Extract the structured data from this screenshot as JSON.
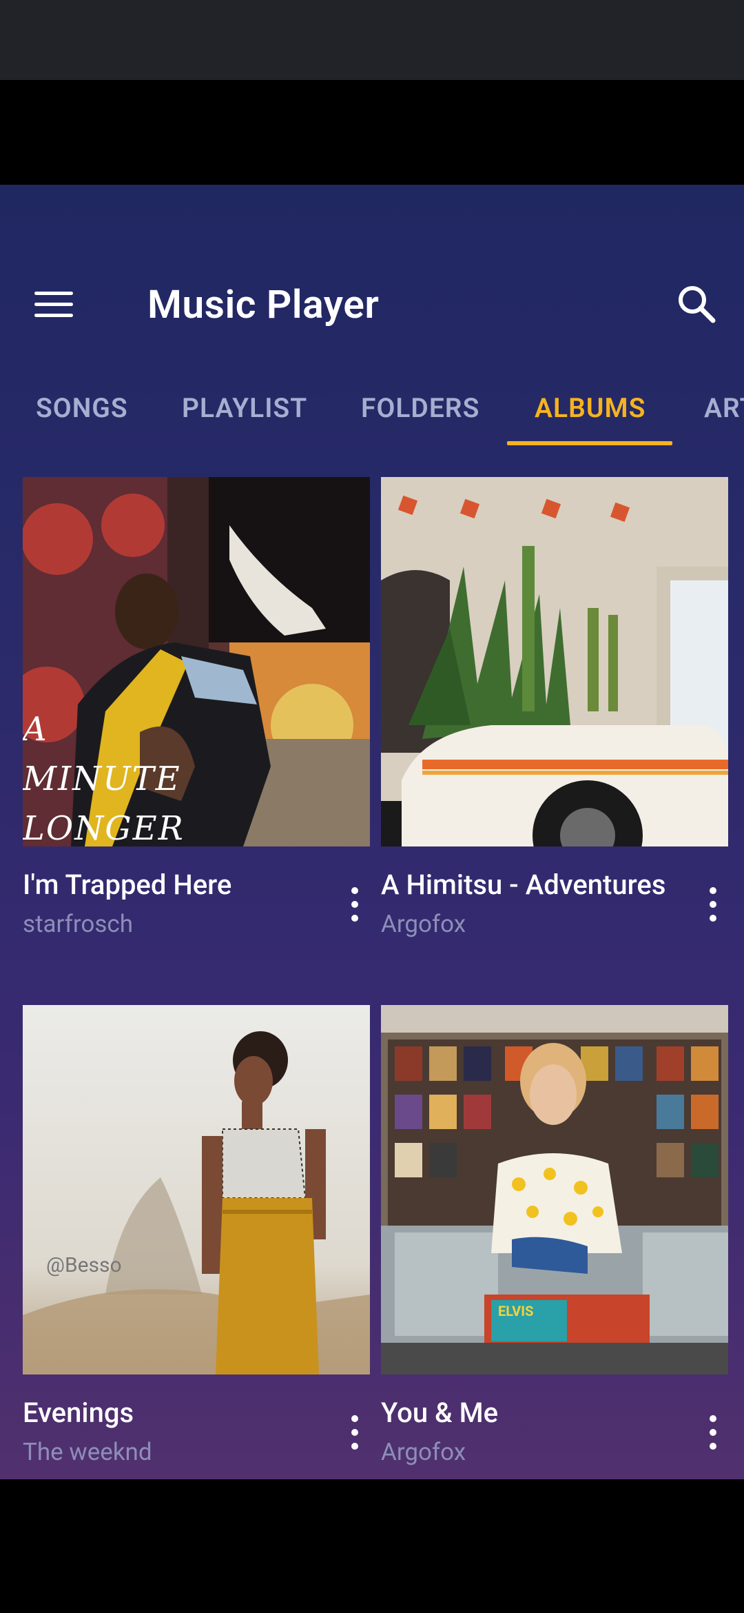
{
  "app": {
    "title": "Music Player"
  },
  "tabs": [
    {
      "label": "SONGS",
      "active": false
    },
    {
      "label": "PLAYLIST",
      "active": false
    },
    {
      "label": "FOLDERS",
      "active": false
    },
    {
      "label": "ALBUMS",
      "active": true
    },
    {
      "label": "ARTISTS",
      "active": false
    }
  ],
  "albums": [
    {
      "title": "I'm Trapped Here",
      "artist": "starfrosch",
      "cover_text": "A MINUTE LONGER"
    },
    {
      "title": "A Himitsu - Adventures",
      "artist": "Argofox"
    },
    {
      "title": "Evenings",
      "artist": "The weeknd",
      "cover_text": "@Besso"
    },
    {
      "title": "You & Me",
      "artist": "Argofox",
      "cover_text": "ELVIS"
    }
  ],
  "colors": {
    "accent": "#f6b31f",
    "tab_inactive": "#a7aed0",
    "artist_text": "#8d8eb8"
  }
}
